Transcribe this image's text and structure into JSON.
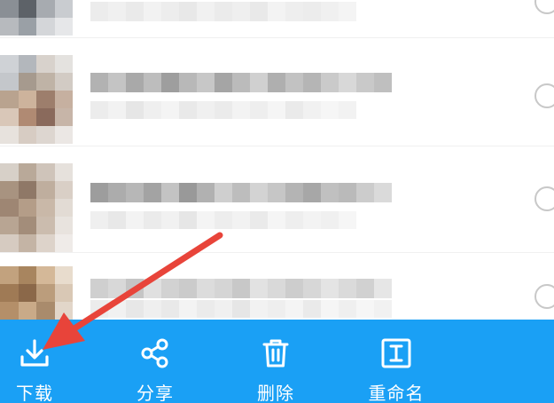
{
  "colors": {
    "toolbar_bg": "#1aa0f5",
    "toolbar_fg": "#ffffff",
    "annotation_arrow": "#e8443a",
    "select_circle": "#c8c8c8"
  },
  "file_list": {
    "rows": [
      {
        "thumbnail": "blurred-image",
        "title": "",
        "meta": "",
        "selected": false
      },
      {
        "thumbnail": "blurred-image",
        "title": "",
        "meta": "",
        "selected": false
      },
      {
        "thumbnail": "blurred-image",
        "title": "",
        "meta": "",
        "selected": false
      },
      {
        "thumbnail": "blurred-image",
        "title": "",
        "meta": "",
        "selected": false
      }
    ]
  },
  "toolbar": {
    "download": {
      "label": "下载",
      "icon": "download-icon"
    },
    "share": {
      "label": "分享",
      "icon": "share-icon"
    },
    "delete": {
      "label": "删除",
      "icon": "trash-icon"
    },
    "rename": {
      "label": "重命名",
      "icon": "rename-icon"
    }
  },
  "annotation": {
    "type": "arrow",
    "points_to": "download"
  }
}
